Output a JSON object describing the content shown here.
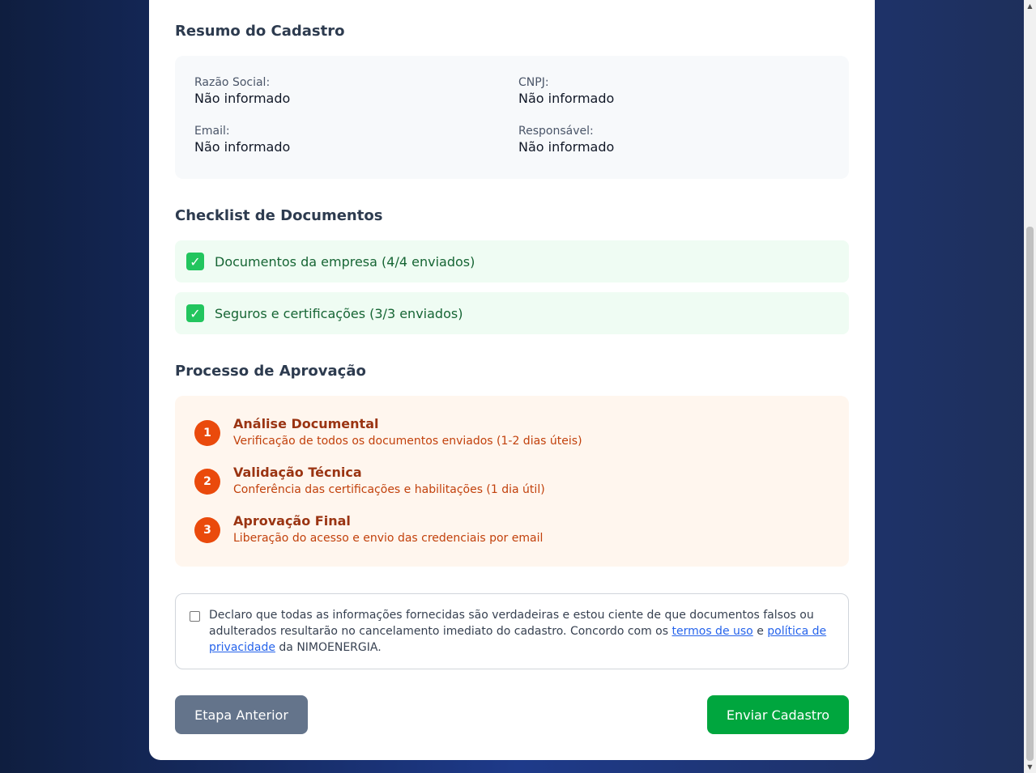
{
  "summary": {
    "title": "Resumo do Cadastro",
    "razao_label": "Razão Social:",
    "razao_value": "Não informado",
    "cnpj_label": "CNPJ:",
    "cnpj_value": "Não informado",
    "email_label": "Email:",
    "email_value": "Não informado",
    "resp_label": "Responsável:",
    "resp_value": "Não informado"
  },
  "checklist": {
    "title": "Checklist de Documentos",
    "items": [
      {
        "icon": "checkmark-icon",
        "label": "Documentos da empresa (4/4 enviados)"
      },
      {
        "icon": "checkmark-icon",
        "label": "Seguros e certificações (3/3 enviados)"
      }
    ]
  },
  "process": {
    "title": "Processo de Aprovação",
    "steps": [
      {
        "num": "1",
        "title": "Análise Documental",
        "desc": "Verificação de todos os documentos enviados (1-2 dias úteis)"
      },
      {
        "num": "2",
        "title": "Validação Técnica",
        "desc": "Conferência das certificações e habilitações (1 dia útil)"
      },
      {
        "num": "3",
        "title": "Aprovação Final",
        "desc": "Liberação do acesso e envio das credenciais por email"
      }
    ]
  },
  "terms": {
    "text_before": "Declaro que todas as informações fornecidas são verdadeiras e estou ciente de que documentos falsos ou adulterados resultarão no cancelamento imediato do cadastro. Concordo com os ",
    "link_terms": "termos de uso",
    "text_and": " e ",
    "link_privacy": "política de privacidade",
    "text_after": " da NIMOENERGIA.",
    "checked": false
  },
  "buttons": {
    "prev": "Etapa Anterior",
    "submit": "Enviar Cadastro"
  },
  "colors": {
    "accent_green": "#00a63e",
    "accent_orange": "#ea4a0c",
    "link_blue": "#2563eb"
  }
}
